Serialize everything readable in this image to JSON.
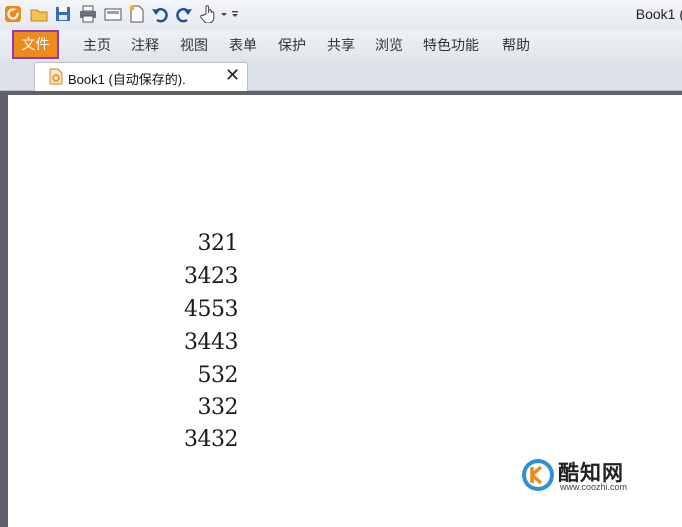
{
  "window": {
    "title": "Book1 ("
  },
  "quick_access": {
    "icons": [
      "app-logo-icon",
      "open-folder-icon",
      "save-icon",
      "print-icon",
      "scan-icon",
      "new-doc-icon",
      "undo-icon",
      "redo-icon",
      "hand-tool-icon",
      "customize-dropdown-icon"
    ]
  },
  "menu": {
    "file": "文件",
    "items": [
      "主页",
      "注释",
      "视图",
      "表单",
      "保护",
      "共享",
      "浏览",
      "特色功能",
      "帮助"
    ]
  },
  "tab": {
    "label": "Book1 (自动保存的).",
    "close": "✕"
  },
  "document": {
    "numbers": [
      "321",
      "3423",
      "4553",
      "3443",
      "532",
      "332",
      "3432"
    ]
  },
  "watermark": {
    "name": "酷知网",
    "url": "www.coozhi.com"
  },
  "colors": {
    "file_menu_bg": "#f08a1c",
    "highlight_border": "#8a3cbf",
    "doc_bg": "#5f6368"
  }
}
